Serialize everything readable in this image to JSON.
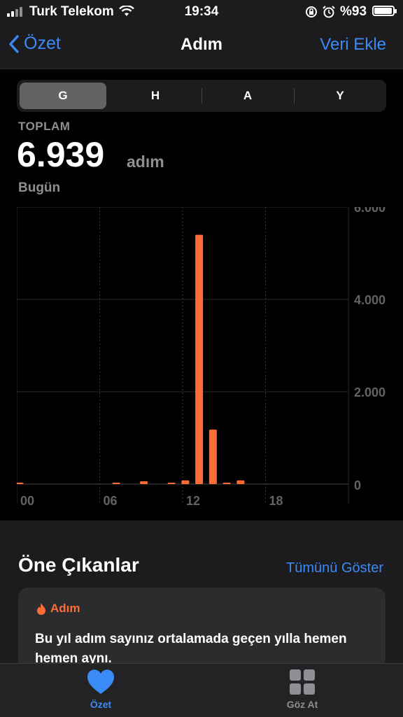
{
  "status": {
    "carrier": "Turk Telekom",
    "time": "19:34",
    "battery": "%93"
  },
  "nav": {
    "back_label": "Özet",
    "title": "Adım",
    "action": "Veri Ekle"
  },
  "segments": [
    "G",
    "H",
    "A",
    "Y"
  ],
  "selected_segment": "G",
  "summary": {
    "label": "TOPLAM",
    "value": "6.939",
    "unit": "adım",
    "date": "Bugün"
  },
  "chart_data": {
    "type": "bar",
    "categories": [
      "00",
      "01",
      "02",
      "03",
      "04",
      "05",
      "06",
      "07",
      "08",
      "09",
      "10",
      "11",
      "12",
      "13",
      "14",
      "15",
      "16",
      "17",
      "18",
      "19",
      "20",
      "21",
      "22",
      "23"
    ],
    "values": [
      20,
      0,
      0,
      0,
      0,
      0,
      0,
      10,
      0,
      60,
      0,
      30,
      80,
      5400,
      1180,
      30,
      80,
      0,
      0,
      0,
      0,
      0,
      0,
      0
    ],
    "x_tick_labels": [
      "00",
      "06",
      "12",
      "18"
    ],
    "y_tick_labels": [
      "0",
      "2.000",
      "4.000",
      "6.000"
    ],
    "ylim": [
      0,
      6000
    ],
    "color": "#ff6b35"
  },
  "highlights": {
    "title": "Öne Çıkanlar",
    "link": "Tümünü Göster",
    "card": {
      "category": "Adım",
      "text": "Bu yıl adım sayınız ortalamada geçen yılla hemen hemen aynı."
    }
  },
  "tabs": [
    {
      "label": "Özet",
      "icon": "heart-icon",
      "active": true,
      "color": "#3b8bf6"
    },
    {
      "label": "Göz At",
      "icon": "grid-icon",
      "active": false,
      "color": "#8e8e93"
    }
  ]
}
